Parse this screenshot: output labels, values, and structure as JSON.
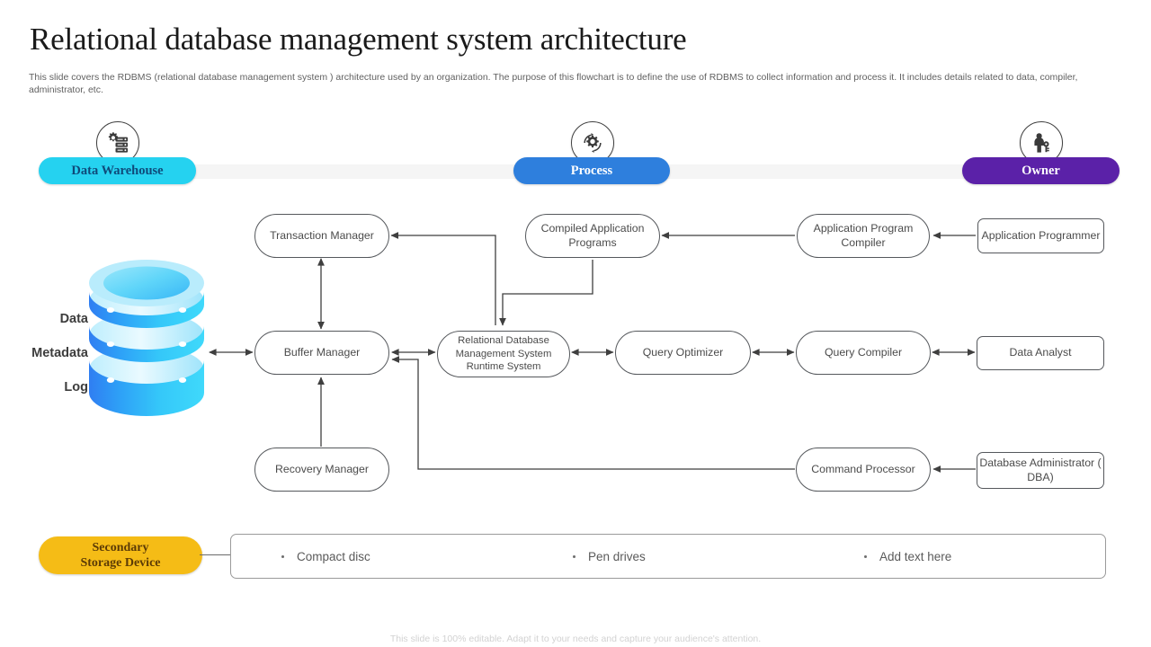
{
  "header": {
    "title": "Relational database management system architecture",
    "subtitle": "This slide covers the RDBMS (relational database management system ) architecture used by an organization. The purpose of this flowchart is to  define the use of RDBMS to  collect information and process it. It includes details related to data, compiler, administrator, etc."
  },
  "categories": [
    {
      "label": "Data Warehouse",
      "color": "#25d2f0",
      "text_color": "#0f4a7a",
      "icon": "database-gear-icon"
    },
    {
      "label": "Process",
      "color": "#2e7fdd",
      "text_color": "#ffffff",
      "icon": "process-gear-icon"
    },
    {
      "label": "Owner",
      "color": "#5b21a8",
      "text_color": "#ffffff",
      "icon": "person-key-icon"
    }
  ],
  "database": {
    "icon": "database-cylinder-icon",
    "labels": [
      "Data",
      "Metadata",
      "Log"
    ]
  },
  "nodes": {
    "transaction_manager": "Transaction Manager",
    "buffer_manager": "Buffer Manager",
    "recovery_manager": "Recovery  Manager",
    "rdbms_runtime": "Relational Database Management System Runtime System",
    "compiled_application_programs": "Compiled  Application Programs",
    "query_optimizer": "Query  Optimizer",
    "command_processor": "Command  Processor",
    "application_program_compiler": "Application Program Compiler",
    "query_compiler": "Query Compiler",
    "application_programmer": "Application Programmer",
    "data_analyst": "Data Analyst",
    "database_administrator": "Database Administrator ( DBA)"
  },
  "secondary_storage": {
    "label_line1": "Secondary",
    "label_line2": "Storage Device",
    "items": [
      "Compact disc",
      "Pen drives",
      "Add text here"
    ]
  },
  "footer": "This slide is 100% editable. Adapt it to your needs and capture your audience's attention."
}
